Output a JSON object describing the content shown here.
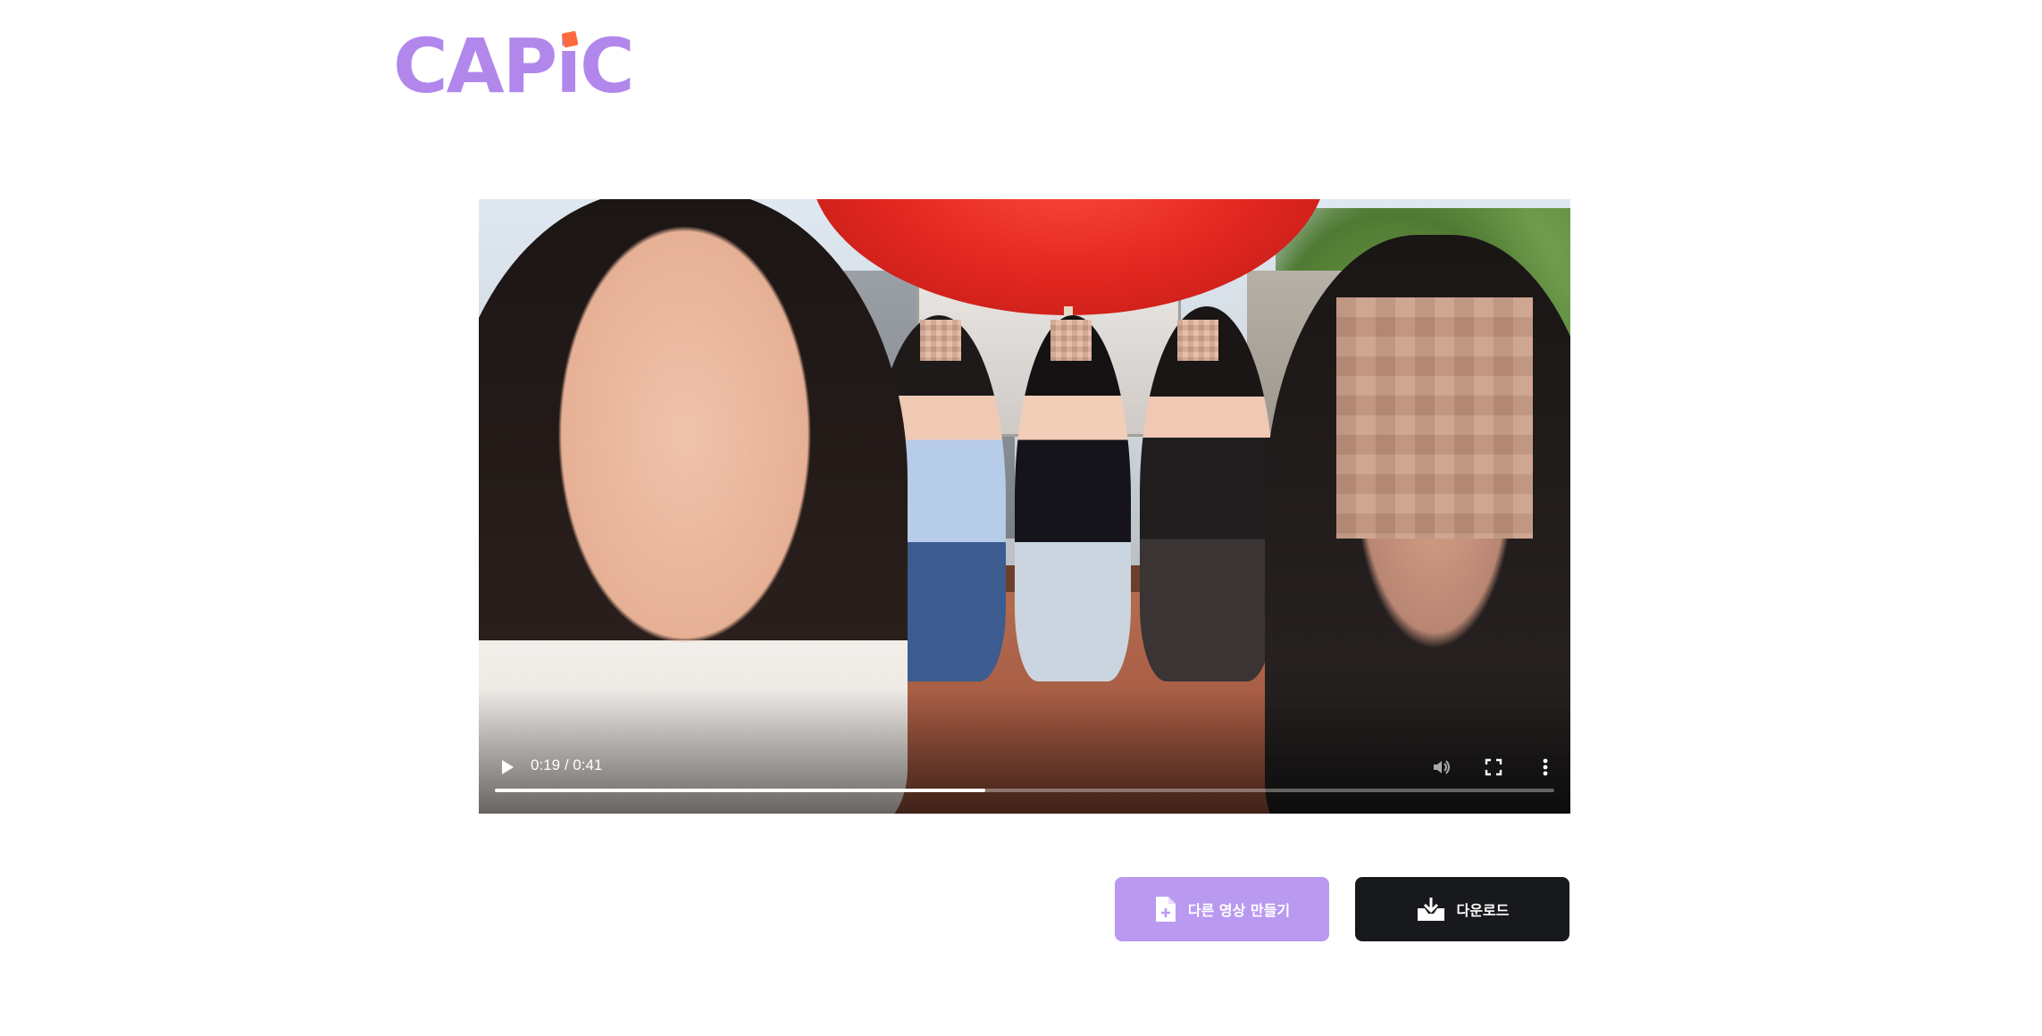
{
  "brand": {
    "logo_text_before": "CAP",
    "logo_text_i": "i",
    "logo_text_after": "C",
    "primary_color": "#b187ec",
    "accent_color": "#ff6a3d"
  },
  "player": {
    "state": "paused",
    "current_time": "0:19",
    "separator": "/",
    "duration": "0:41",
    "time_display": "0:19 / 0:41",
    "progress_fraction": 0.463,
    "icons": {
      "play": "play-icon",
      "mute": "volume-icon",
      "fullscreen": "fullscreen-icon",
      "more": "more-vertical-icon"
    }
  },
  "actions": {
    "make_another_label": "다른 영상 만들기",
    "make_another_icon": "file-plus-icon",
    "download_label": "다운로드",
    "download_icon": "download-icon",
    "make_another_color": "#b99af0",
    "download_color": "#18191c"
  }
}
